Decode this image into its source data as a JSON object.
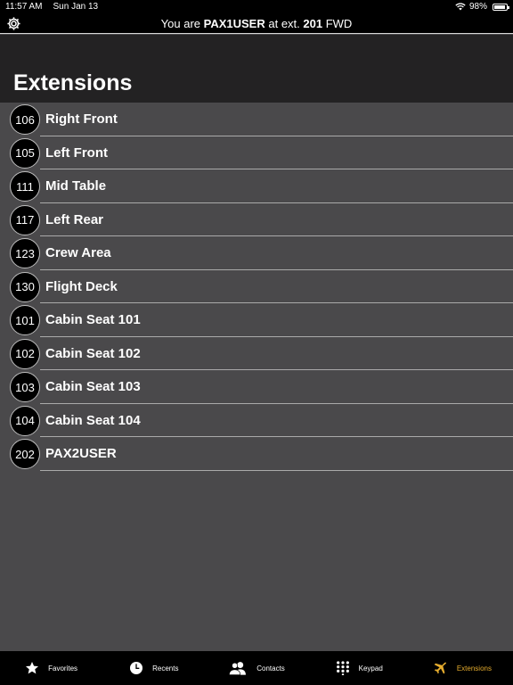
{
  "status": {
    "time": "11:57 AM",
    "date": "Sun Jan 13",
    "battery": "98%"
  },
  "topbar": {
    "prefix": "You are ",
    "user": "PAX1USER",
    "middle": " at ext. ",
    "ext": "201",
    "suffix": " FWD"
  },
  "page": {
    "title": "Extensions"
  },
  "extensions": [
    {
      "number": "106",
      "name": "Right Front"
    },
    {
      "number": "105",
      "name": "Left Front"
    },
    {
      "number": "111",
      "name": "Mid Table"
    },
    {
      "number": "117",
      "name": "Left Rear"
    },
    {
      "number": "123",
      "name": "Crew Area"
    },
    {
      "number": "130",
      "name": "Flight Deck"
    },
    {
      "number": "101",
      "name": "Cabin Seat 101"
    },
    {
      "number": "102",
      "name": "Cabin Seat 102"
    },
    {
      "number": "103",
      "name": "Cabin Seat 103"
    },
    {
      "number": "104",
      "name": "Cabin Seat 104"
    },
    {
      "number": "202",
      "name": "PAX2USER"
    }
  ],
  "tabs": [
    {
      "label": "Favorites",
      "icon": "star-icon"
    },
    {
      "label": "Recents",
      "icon": "clock-icon"
    },
    {
      "label": "Contacts",
      "icon": "contacts-icon"
    },
    {
      "label": "Keypad",
      "icon": "keypad-icon"
    },
    {
      "label": "Extensions",
      "icon": "airplane-icon",
      "active": true
    }
  ],
  "colors": {
    "accent": "#e5ac2e",
    "background": "#4a494b",
    "header": "#232223"
  }
}
